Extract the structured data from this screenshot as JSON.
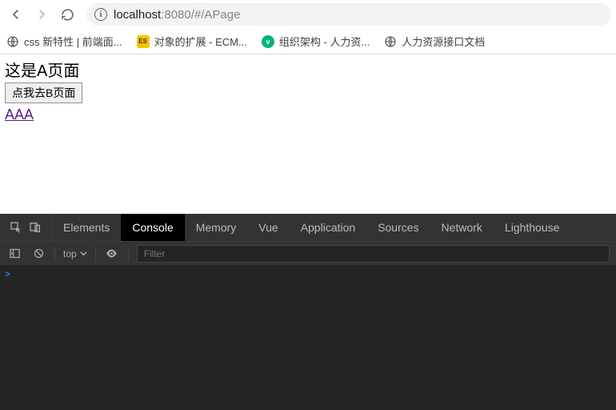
{
  "browser": {
    "url_host": "localhost",
    "url_rest": ":8080/#/APage"
  },
  "bookmarks": [
    {
      "icon": "globe",
      "label": "css 新特性 | 前端面..."
    },
    {
      "icon": "es",
      "label": "对象的扩展 - ECM..."
    },
    {
      "icon": "v",
      "label": "组织架构 - 人力资..."
    },
    {
      "icon": "globe",
      "label": "人力资源接口文档"
    }
  ],
  "page": {
    "heading": "这是A页面",
    "button": "点我去B页面",
    "link": "AAA"
  },
  "devtools": {
    "tabs": [
      "Elements",
      "Console",
      "Memory",
      "Vue",
      "Application",
      "Sources",
      "Network",
      "Lighthouse"
    ],
    "active_tab": "Console",
    "context": "top",
    "filter_placeholder": "Filter",
    "prompt": ">"
  }
}
